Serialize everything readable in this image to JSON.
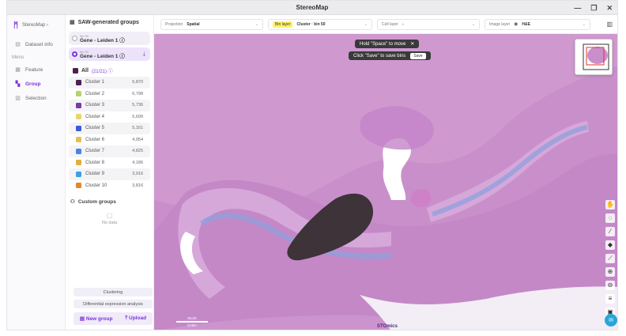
{
  "window": {
    "title": "StereoMap",
    "controls": [
      "—",
      "❐",
      "✕"
    ]
  },
  "brand": {
    "logo": "ᛗ",
    "name": "StereoMap ›"
  },
  "nav": {
    "dataset": "Dataset info",
    "menu_label": "Menu",
    "items": [
      {
        "label": "Feature",
        "icon": "feature-icon"
      },
      {
        "label": "Group",
        "icon": "group-icon"
      },
      {
        "label": "Selection",
        "icon": "selection-icon"
      }
    ]
  },
  "panel": {
    "title": "SAW-generated groups",
    "groups": [
      {
        "small": "bin 50",
        "name": "Gene - Leiden 1 ⓘ"
      },
      {
        "small": "bin 50",
        "name": "Gene - Leiden 1 ⓘ"
      }
    ],
    "all_label": "All",
    "all_count": "(21/21) ⓘ",
    "clusters": [
      {
        "label": "Cluster 1",
        "count": "6,870",
        "color": "#4b1f4e"
      },
      {
        "label": "Cluster 2",
        "count": "6,798",
        "color": "#b5d36e"
      },
      {
        "label": "Cluster 3",
        "count": "5,736",
        "color": "#7a3aa0"
      },
      {
        "label": "Cluster 4",
        "count": "5,699",
        "color": "#e8d56b"
      },
      {
        "label": "Cluster 5",
        "count": "5,161",
        "color": "#3e5bd6"
      },
      {
        "label": "Cluster 6",
        "count": "4,954",
        "color": "#e6c04e"
      },
      {
        "label": "Cluster 7",
        "count": "4,825",
        "color": "#4a84e0"
      },
      {
        "label": "Cluster 8",
        "count": "4,186",
        "color": "#e0b040"
      },
      {
        "label": "Cluster 9",
        "count": "3,916",
        "color": "#3aa0e0"
      },
      {
        "label": "Cluster 10",
        "count": "3,816",
        "color": "#e0882c"
      }
    ],
    "custom_groups": "Custom groups",
    "no_data": "No data",
    "clustering": "Clustering",
    "diff_expr": "Differential expression analysis",
    "new_group": "New group",
    "upload": "Upload"
  },
  "toolbar": {
    "projection_label": "Projection",
    "projection_value": "Spatial",
    "bin_layer_label": "Bin layer",
    "bin_layer_value": "Cluster · bin 50",
    "cell_layer_label": "Cell layer",
    "cell_layer_value": "-",
    "image_layer_label": "Image layer",
    "image_layer_value": "H&E"
  },
  "canvas": {
    "tip_space": "Hold \"Space\" to move",
    "tip_space_close": "✕",
    "tip_save": "Click \"Save\" to save bins",
    "save_btn": "Save",
    "scale_value": "50,00",
    "scale_unit": "⊡ Bin",
    "watermark": "STOmics"
  },
  "colors": {
    "accent": "#7b35d6",
    "tissue": "#c88ecb",
    "fab": "#27a6d8"
  }
}
